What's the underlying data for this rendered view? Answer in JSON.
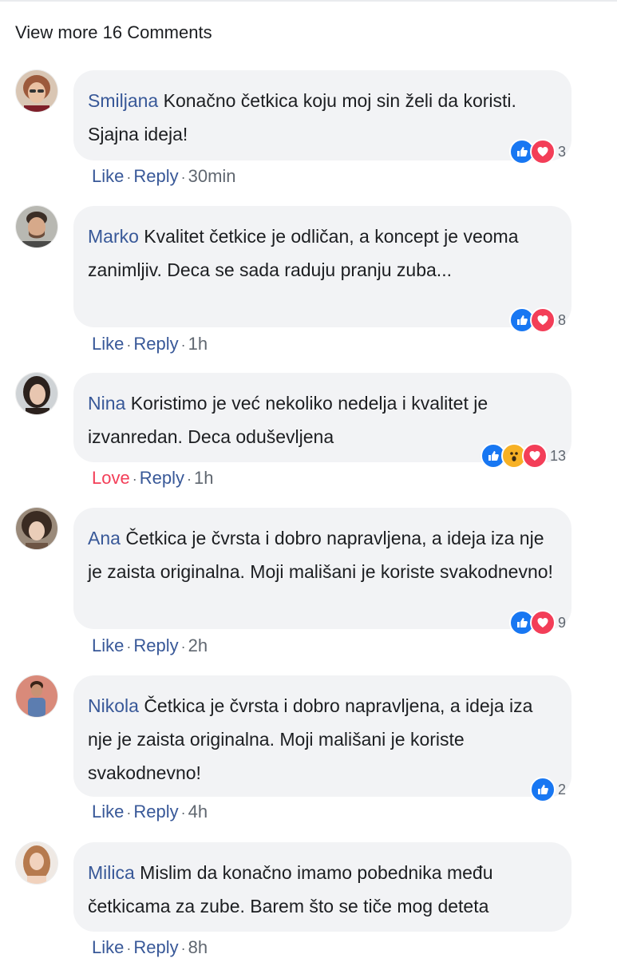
{
  "view_more": "View more 16 Comments",
  "comments": [
    {
      "author": "Smiljana",
      "text": "Konačno četkica koju moj sin želi da koristi. Sjajna ideja!",
      "reaction_icons": [
        "like-icon",
        "love-icon"
      ],
      "reaction_count": "3",
      "actions": {
        "react": "Like",
        "reply": "Reply",
        "sep": "·",
        "time": "30min"
      }
    },
    {
      "author": "Marko",
      "text": "Kvalitet četkice je odličan, a koncept je veoma zanimljiv. Deca se sada raduju pranju zuba...",
      "reaction_icons": [
        "like-icon",
        "love-icon"
      ],
      "reaction_count": "8",
      "actions": {
        "react": "Like",
        "reply": "Reply",
        "sep": "·",
        "time": "1h"
      }
    },
    {
      "author": "Nina",
      "text": "Koristimo je već nekoliko nedelja i kvalitet je izvanredan. Deca oduševljena",
      "reaction_icons": [
        "like-icon",
        "wow-icon",
        "love-icon"
      ],
      "reaction_count": "13",
      "actions": {
        "react": "Love",
        "reply": "Reply",
        "sep": "·",
        "time": "1h"
      }
    },
    {
      "author": "Ana",
      "text": "Četkica je čvrsta i dobro napravljena, a ideja iza nje je zaista originalna. Moji mališani je koriste svakodnevno!",
      "reaction_icons": [
        "like-icon",
        "love-icon"
      ],
      "reaction_count": "9",
      "actions": {
        "react": "Like",
        "reply": "Reply",
        "sep": "·",
        "time": "2h"
      }
    },
    {
      "author": "Nikola",
      "text": "Četkica je čvrsta i dobro napravljena, a ideja iza nje je zaista originalna. Moji mališani je koriste svakodnevno!",
      "reaction_icons": [
        "like-icon"
      ],
      "reaction_count": "2",
      "actions": {
        "react": "Like",
        "reply": "Reply",
        "sep": "·",
        "time": "4h"
      }
    },
    {
      "author": "Milica",
      "text": "Mislim da konačno imamo pobednika među četkicama za zube. Barem što se tiče mog deteta",
      "reaction_icons": [],
      "reaction_count": "",
      "actions": {
        "react": "Like",
        "reply": "Reply",
        "sep": "·",
        "time": "8h"
      }
    }
  ],
  "colors": {
    "author": "#385898",
    "bubble": "#f2f3f5",
    "like": "#1877f2",
    "love": "#f33e58",
    "wow": "#f7b125",
    "meta": "#606770"
  }
}
